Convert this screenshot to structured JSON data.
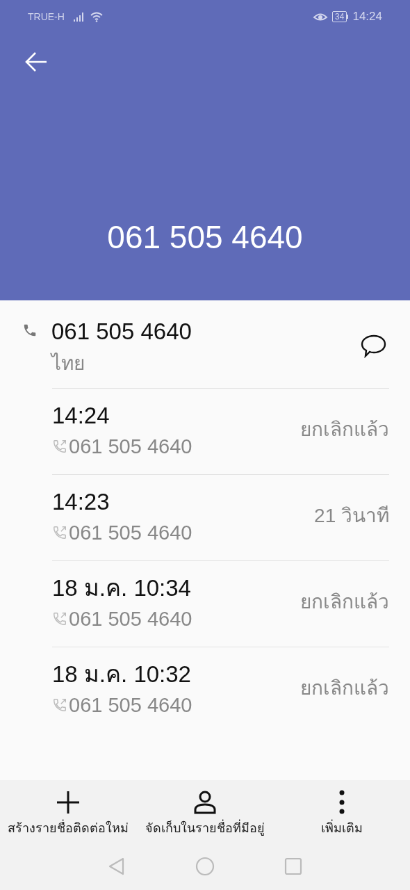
{
  "status_bar": {
    "carrier": "TRUE-H",
    "battery": "34",
    "time": "14:24"
  },
  "header": {
    "title": "061 505 4640"
  },
  "contact": {
    "number": "061 505 4640",
    "location": "ไทย"
  },
  "calls": [
    {
      "time": "14:24",
      "number": "061 505 4640",
      "result": "ยกเลิกแล้ว"
    },
    {
      "time": "14:23",
      "number": "061 505 4640",
      "result": "21 วินาที"
    },
    {
      "time": "18 ม.ค. 10:34",
      "number": "061 505 4640",
      "result": "ยกเลิกแล้ว"
    },
    {
      "time": "18 ม.ค. 10:32",
      "number": "061 505 4640",
      "result": "ยกเลิกแล้ว"
    }
  ],
  "actions": [
    {
      "kind": "add",
      "label": "สร้างรายชื่อติดต่อใหม่"
    },
    {
      "kind": "person",
      "label": "จัดเก็บในรายชื่อที่มีอยู่"
    },
    {
      "kind": "more",
      "label": "เพิ่มเติม"
    }
  ]
}
